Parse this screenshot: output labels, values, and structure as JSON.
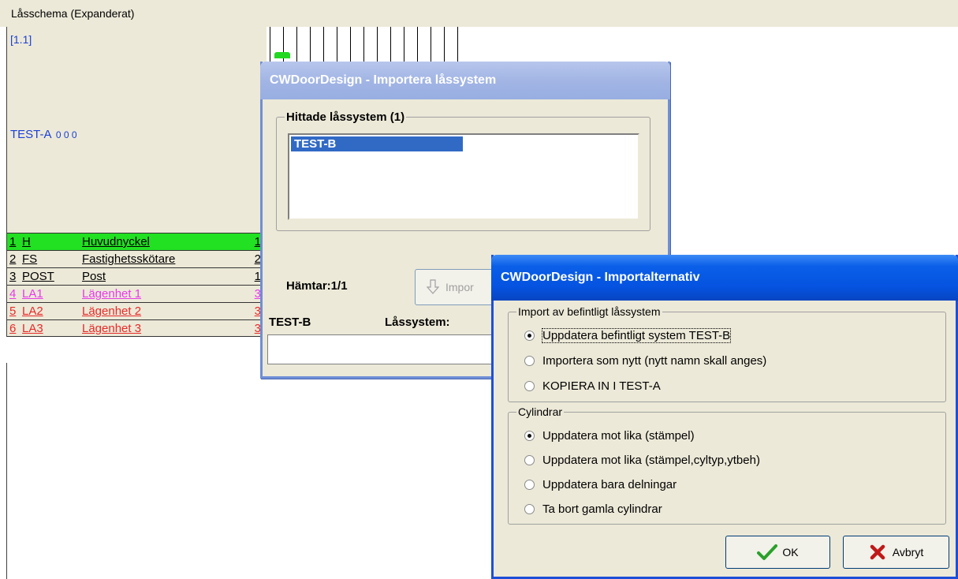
{
  "app": {
    "title": "Låsschema (Expanderat)",
    "coord": "[1.1]",
    "system_name": "TEST-A",
    "system_zeros": "0 0 0",
    "keys": [
      {
        "n": "1",
        "code": "H",
        "desc": "Huvudnyckel",
        "qty": "1",
        "color": "#000000",
        "bg": "#22e022"
      },
      {
        "n": "2",
        "code": "FS",
        "desc": "Fastighetsskötare",
        "qty": "2",
        "color": "#000000",
        "bg": "#ece9d8"
      },
      {
        "n": "3",
        "code": "POST",
        "desc": "Post",
        "qty": "1",
        "color": "#000000",
        "bg": "#ece9d8"
      },
      {
        "n": "4",
        "code": "LA1",
        "desc": "Lägenhet 1",
        "qty": "3",
        "color": "#e83ae8",
        "bg": "#ece9d8"
      },
      {
        "n": "5",
        "code": "LA2",
        "desc": "Lägenhet 2",
        "qty": "3",
        "color": "#e82a2a",
        "bg": "#ece9d8"
      },
      {
        "n": "6",
        "code": "LA3",
        "desc": "Lägenhet 3",
        "qty": "3",
        "color": "#e82a2a",
        "bg": "#ece9d8"
      }
    ]
  },
  "import_dialog": {
    "title": "CWDoorDesign - Importera låssystem",
    "group_label": "Hittade låssystem (1)",
    "items": [
      "TEST-B"
    ],
    "progress": "Hämtar:1/1",
    "import_button": "Impor",
    "footer_left": "TEST-B",
    "footer_label": "Låssystem:"
  },
  "options_dialog": {
    "title": "CWDoorDesign - Importalternativ",
    "group1_label": "Import av befintligt låssystem",
    "group1_options": [
      {
        "label": "Uppdatera befintligt system TEST-B",
        "selected": true
      },
      {
        "label": "Importera som nytt (nytt namn skall anges)",
        "selected": false
      },
      {
        "label": "KOPIERA IN I TEST-A",
        "selected": false
      }
    ],
    "group2_label": "Cylindrar",
    "group2_options": [
      {
        "label": "Uppdatera mot lika (stämpel)",
        "selected": true
      },
      {
        "label": "Uppdatera mot lika (stämpel,cyltyp,ytbeh)",
        "selected": false
      },
      {
        "label": "Uppdatera bara delningar",
        "selected": false
      },
      {
        "label": "Ta bort gamla cylindrar",
        "selected": false
      }
    ],
    "ok_label": "OK",
    "cancel_label": "Avbryt"
  }
}
